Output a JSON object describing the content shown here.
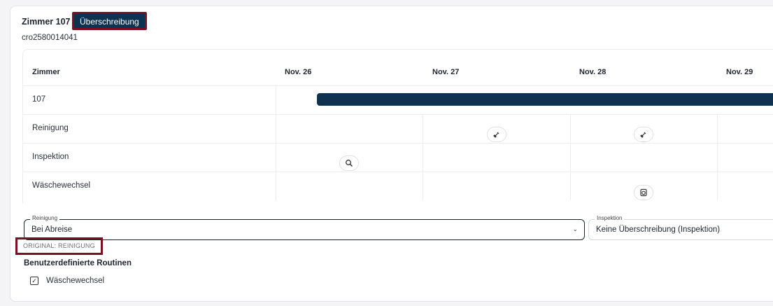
{
  "header": {
    "room_title": "Zimmer 107",
    "override_label": "Überschreibung",
    "room_code": "cro2580014041"
  },
  "grid": {
    "room_column_header": "Zimmer",
    "days": [
      "Nov. 26",
      "Nov. 27",
      "Nov. 28",
      "Nov. 29"
    ],
    "rows": [
      {
        "label": "107"
      },
      {
        "label": "Reinigung"
      },
      {
        "label": "Inspektion"
      },
      {
        "label": "Wäschewechsel"
      }
    ],
    "icons": {
      "cleaning": "broom-icon",
      "inspection": "search-icon",
      "linen": "laundry-icon"
    }
  },
  "cleaning_select": {
    "legend": "Reinigung",
    "value": "Bei Abreise"
  },
  "inspection_select": {
    "legend": "Inspektion",
    "value": "Keine Überschreibung (Inspektion)"
  },
  "original_tag": "ORIGINAL: REINIGUNG",
  "routines": {
    "title": "Benutzerdefinierte Routinen",
    "items": [
      {
        "label": "Wäschewechsel",
        "checked": true
      }
    ]
  },
  "colors": {
    "accent": "#0e3350",
    "highlight_border": "#7a1022"
  }
}
